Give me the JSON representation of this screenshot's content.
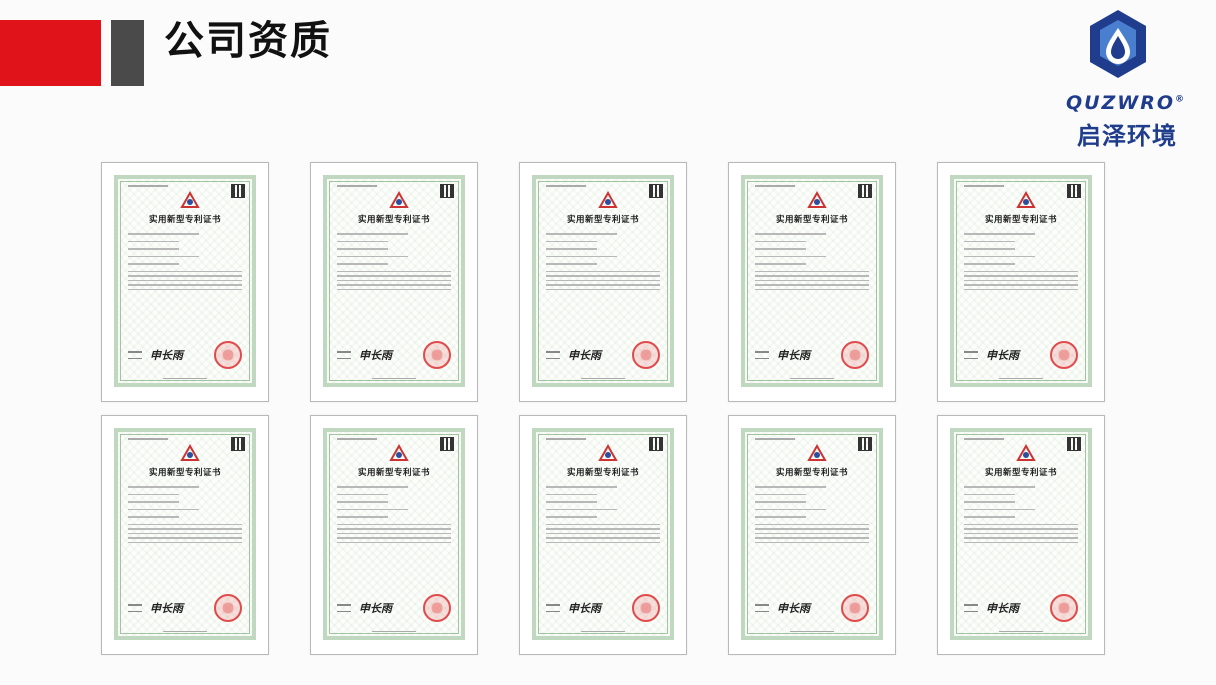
{
  "header": {
    "title": "公司资质"
  },
  "logo": {
    "brand_en": "QUZWRO",
    "registered": "®",
    "brand_cn": "启泽环境",
    "colors": {
      "mark_dark": "#1f3d8c",
      "mark_light": "#4a7fd0",
      "accent": "#e0121a"
    }
  },
  "certificates": [
    {
      "title": "实用新型专利证书"
    },
    {
      "title": "实用新型专利证书"
    },
    {
      "title": "实用新型专利证书"
    },
    {
      "title": "实用新型专利证书"
    },
    {
      "title": "实用新型专利证书"
    },
    {
      "title": "实用新型专利证书"
    },
    {
      "title": "实用新型专利证书"
    },
    {
      "title": "实用新型专利证书"
    },
    {
      "title": "实用新型专利证书"
    },
    {
      "title": "实用新型专利证书"
    }
  ]
}
